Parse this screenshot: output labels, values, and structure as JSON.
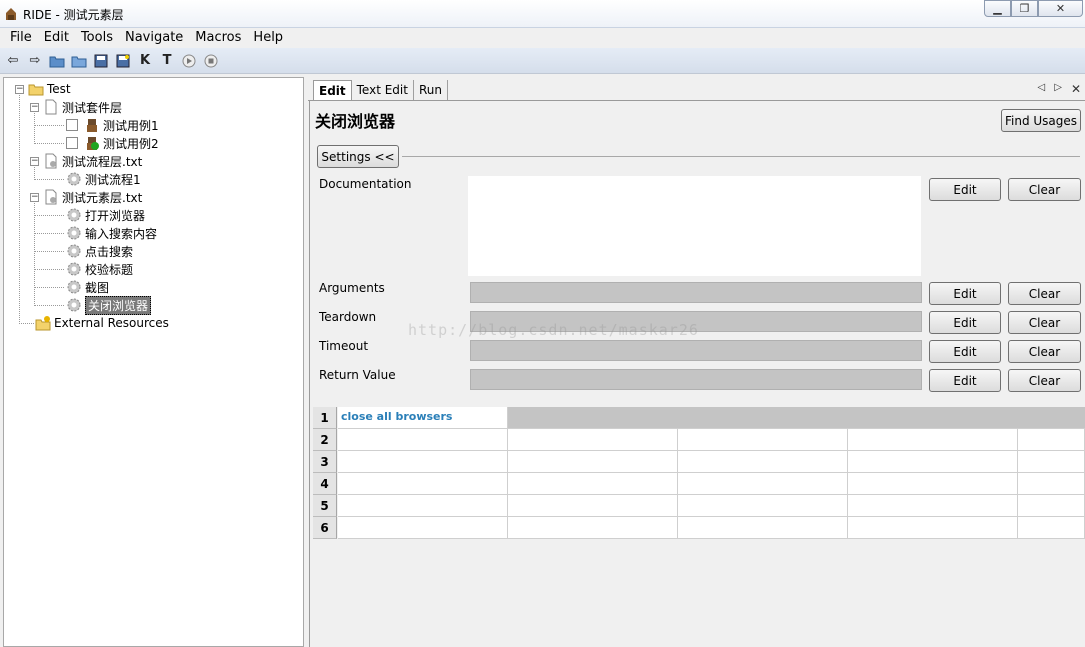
{
  "window": {
    "title": "RIDE - 测试元素层",
    "min_icon": "minimize-icon",
    "max_icon": "maximize-icon",
    "close_icon": "close-icon"
  },
  "menu": [
    "File",
    "Edit",
    "Tools",
    "Navigate",
    "Macros",
    "Help"
  ],
  "tree": {
    "root": "Test",
    "suite": "测试套件层",
    "case1": "测试用例1",
    "case2": "测试用例2",
    "flow_file": "测试流程层.txt",
    "flow1": "测试流程1",
    "element_file": "测试元素层.txt",
    "kw1": "打开浏览器",
    "kw2": "输入搜索内容",
    "kw3": "点击搜索",
    "kw4": "校验标题",
    "kw5": "截图",
    "kw6": "关闭浏览器",
    "external": "External Resources"
  },
  "tabs": [
    "Edit",
    "Text Edit",
    "Run"
  ],
  "editor": {
    "title": "关闭浏览器",
    "find_usages": "Find Usages",
    "settings": "Settings <<",
    "documentation": "Documentation",
    "arguments": "Arguments",
    "teardown": "Teardown",
    "timeout": "Timeout",
    "return_value": "Return Value",
    "edit": "Edit",
    "clear": "Clear",
    "watermark": "http://blog.csdn.net/maskar26"
  },
  "grid": {
    "rows": [
      "1",
      "2",
      "3",
      "4",
      "5",
      "6"
    ],
    "cell_1_1": "close all browsers"
  },
  "colors": {
    "keyword_text": "#2a7fb8",
    "selected_bg": "#7a7a7a"
  }
}
